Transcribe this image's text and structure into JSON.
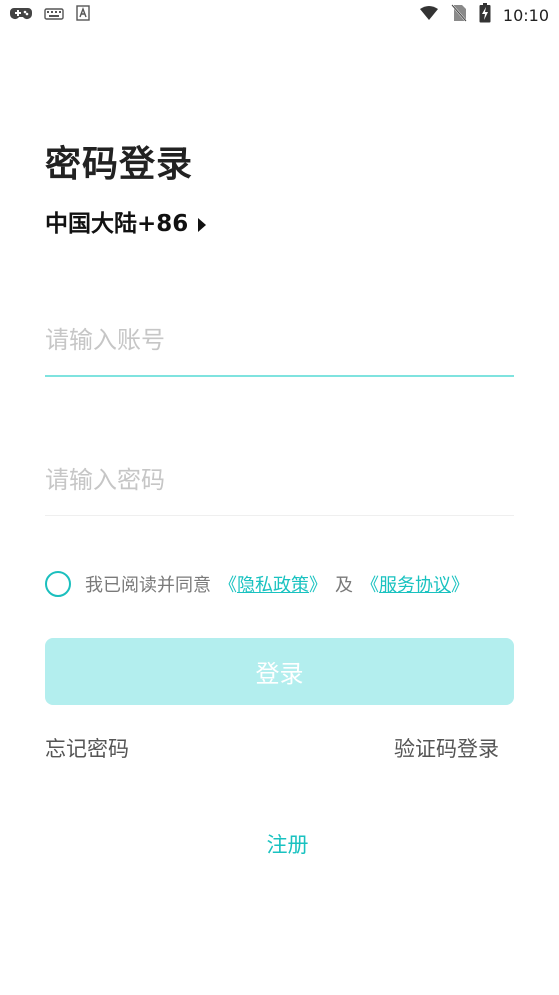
{
  "status_bar": {
    "icons_left": [
      "gamepad-icon",
      "keyboard-icon",
      "text-a-icon"
    ],
    "icons_right": [
      "wifi-icon",
      "no-sim-icon",
      "battery-charging-icon"
    ],
    "time": "10:10"
  },
  "page": {
    "title": "密码登录",
    "region_label": "中国大陆+86",
    "account_placeholder": "请输入账号",
    "password_placeholder": "请输入密码",
    "agree_prefix": "我已阅读并同意",
    "privacy_open": "《",
    "privacy_text": "隐私政策",
    "privacy_close": "》",
    "and_text": "及",
    "terms_open": "《",
    "terms_text": "服务协议",
    "terms_close": "》",
    "login_label": "登录",
    "forgot_password": "忘记密码",
    "sms_login": "验证码登录",
    "register": "注册"
  },
  "colors": {
    "accent": "#19c2c0",
    "login_button_bg": "#b3eeee",
    "active_underline": "#7fe3df",
    "placeholder": "#c6c6c6"
  }
}
